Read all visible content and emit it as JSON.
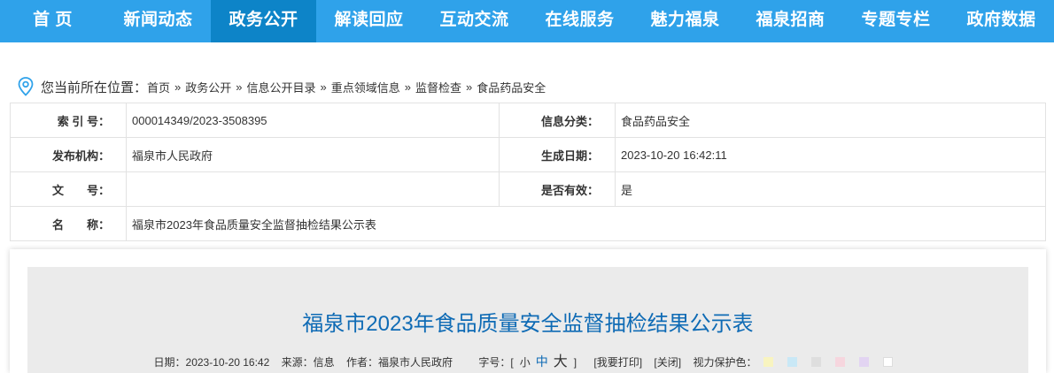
{
  "nav": {
    "items": [
      {
        "label": "首 页"
      },
      {
        "label": "新闻动态"
      },
      {
        "label": "政务公开",
        "active": true
      },
      {
        "label": "解读回应"
      },
      {
        "label": "互动交流"
      },
      {
        "label": "在线服务"
      },
      {
        "label": "魅力福泉"
      },
      {
        "label": "福泉招商"
      },
      {
        "label": "专题专栏"
      },
      {
        "label": "政府数据"
      }
    ]
  },
  "location": {
    "prefix": "您当前所在位置：",
    "crumbs": [
      "首页",
      "政务公开",
      "信息公开目录",
      "重点领域信息",
      "监督检查",
      "食品药品安全"
    ],
    "separator": "»",
    "icon": "location-pin-icon"
  },
  "meta": {
    "index_label": "索 引 号：",
    "index_value": "000014349/2023-3508395",
    "category_label": "信息分类：",
    "category_value": "食品药品安全",
    "publisher_label": "发布机构：",
    "publisher_value": "福泉市人民政府",
    "date_label": "生成日期：",
    "date_value": "2023-10-20 16:42:11",
    "docno_label": "文　　号：",
    "docno_value": "",
    "valid_label": "是否有效：",
    "valid_value": "是",
    "name_label": "名　　称：",
    "name_value": "福泉市2023年食品质量安全监督抽检结果公示表"
  },
  "article": {
    "title": "福泉市2023年食品质量安全监督抽检结果公示表",
    "date": "日期：2023-10-20 16:42",
    "source": "来源：信息",
    "author": "作者：福泉市人民政府",
    "fontsize_label": "字号：[",
    "fs_small": "小",
    "fs_mid": "中",
    "fs_big": "大",
    "fontsize_end": "]",
    "print": "[我要打印]",
    "close": "[关闭]",
    "eye_label": "视力保护色：",
    "swatches": [
      "#f8f4c0",
      "#c9e8f6",
      "#dedede",
      "#f6d6de",
      "#e2d4f2",
      "#ffffff"
    ]
  },
  "colors": {
    "nav_bg": "#2fa2ea",
    "nav_active": "#0d84c8",
    "title": "#0f6bb5"
  }
}
